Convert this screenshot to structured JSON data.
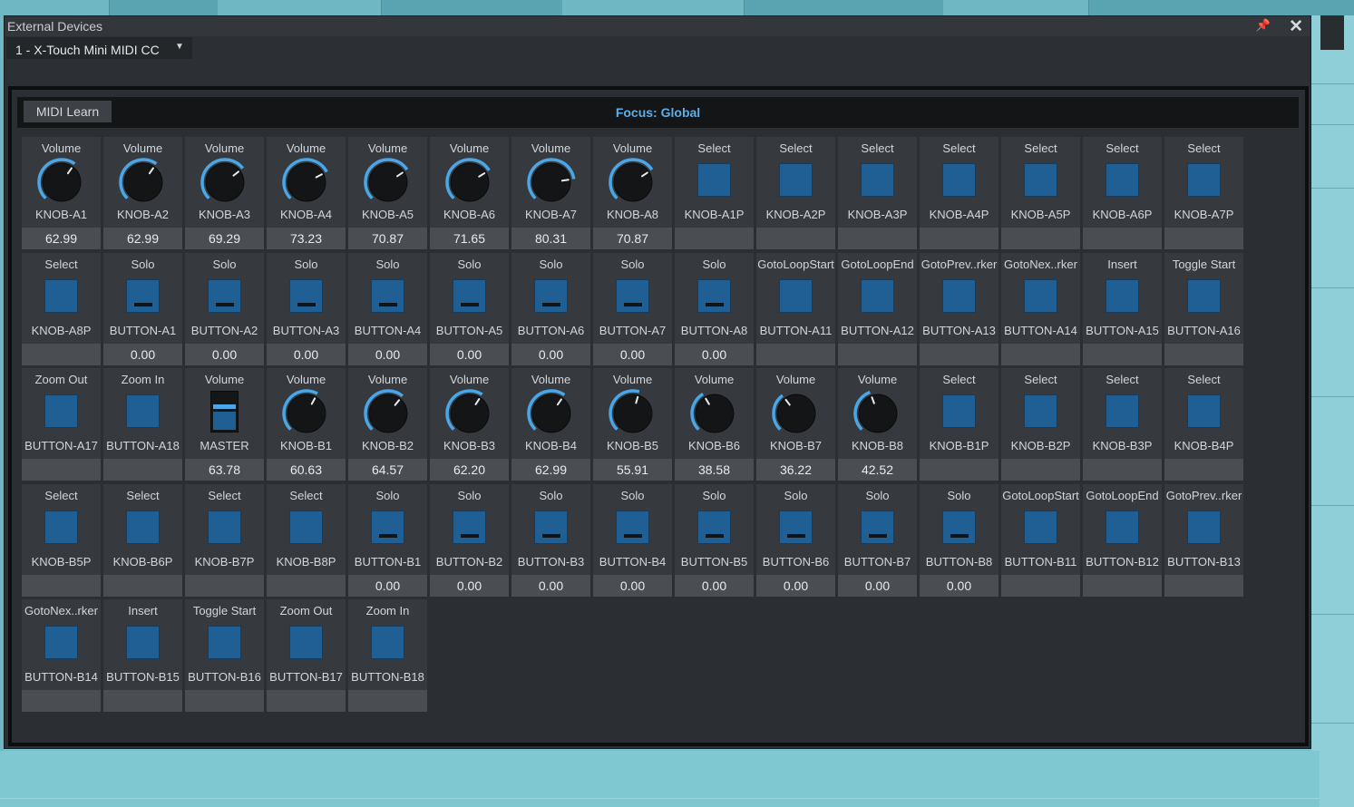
{
  "window": {
    "title": "External Devices",
    "device": "1 - X-Touch Mini MIDI CC"
  },
  "toolbar": {
    "learn": "MIDI Learn",
    "focus": "Focus: Global"
  },
  "colors": {
    "accent": "#4aa6e6",
    "pad": "#1f5f94",
    "focus_text": "#5eaee8"
  },
  "controls": [
    {
      "title": "Volume",
      "name": "KNOB-A1",
      "type": "knob",
      "value": "62.99"
    },
    {
      "title": "Volume",
      "name": "KNOB-A2",
      "type": "knob",
      "value": "62.99"
    },
    {
      "title": "Volume",
      "name": "KNOB-A3",
      "type": "knob",
      "value": "69.29"
    },
    {
      "title": "Volume",
      "name": "KNOB-A4",
      "type": "knob",
      "value": "73.23"
    },
    {
      "title": "Volume",
      "name": "KNOB-A5",
      "type": "knob",
      "value": "70.87"
    },
    {
      "title": "Volume",
      "name": "KNOB-A6",
      "type": "knob",
      "value": "71.65"
    },
    {
      "title": "Volume",
      "name": "KNOB-A7",
      "type": "knob",
      "value": "80.31"
    },
    {
      "title": "Volume",
      "name": "KNOB-A8",
      "type": "knob",
      "value": "70.87"
    },
    {
      "title": "Select",
      "name": "KNOB-A1P",
      "type": "pad",
      "value": ""
    },
    {
      "title": "Select",
      "name": "KNOB-A2P",
      "type": "pad",
      "value": ""
    },
    {
      "title": "Select",
      "name": "KNOB-A3P",
      "type": "pad",
      "value": ""
    },
    {
      "title": "Select",
      "name": "KNOB-A4P",
      "type": "pad",
      "value": ""
    },
    {
      "title": "Select",
      "name": "KNOB-A5P",
      "type": "pad",
      "value": ""
    },
    {
      "title": "Select",
      "name": "KNOB-A6P",
      "type": "pad",
      "value": ""
    },
    {
      "title": "Select",
      "name": "KNOB-A7P",
      "type": "pad",
      "value": ""
    },
    {
      "title": "Select",
      "name": "KNOB-A8P",
      "type": "pad",
      "value": ""
    },
    {
      "title": "Solo",
      "name": "BUTTON-A1",
      "type": "padbar",
      "value": "0.00"
    },
    {
      "title": "Solo",
      "name": "BUTTON-A2",
      "type": "padbar",
      "value": "0.00"
    },
    {
      "title": "Solo",
      "name": "BUTTON-A3",
      "type": "padbar",
      "value": "0.00"
    },
    {
      "title": "Solo",
      "name": "BUTTON-A4",
      "type": "padbar",
      "value": "0.00"
    },
    {
      "title": "Solo",
      "name": "BUTTON-A5",
      "type": "padbar",
      "value": "0.00"
    },
    {
      "title": "Solo",
      "name": "BUTTON-A6",
      "type": "padbar",
      "value": "0.00"
    },
    {
      "title": "Solo",
      "name": "BUTTON-A7",
      "type": "padbar",
      "value": "0.00"
    },
    {
      "title": "Solo",
      "name": "BUTTON-A8",
      "type": "padbar",
      "value": "0.00"
    },
    {
      "title": "GotoLoopStart",
      "name": "BUTTON-A11",
      "type": "pad",
      "value": ""
    },
    {
      "title": "GotoLoopEnd",
      "name": "BUTTON-A12",
      "type": "pad",
      "value": ""
    },
    {
      "title": "GotoPrev..rker",
      "name": "BUTTON-A13",
      "type": "pad",
      "value": ""
    },
    {
      "title": "GotoNex..rker",
      "name": "BUTTON-A14",
      "type": "pad",
      "value": ""
    },
    {
      "title": "Insert",
      "name": "BUTTON-A15",
      "type": "pad",
      "value": ""
    },
    {
      "title": "Toggle Start",
      "name": "BUTTON-A16",
      "type": "pad",
      "value": ""
    },
    {
      "title": "Zoom Out",
      "name": "BUTTON-A17",
      "type": "pad",
      "value": ""
    },
    {
      "title": "Zoom In",
      "name": "BUTTON-A18",
      "type": "pad",
      "value": ""
    },
    {
      "title": "Volume",
      "name": "MASTER",
      "type": "fader",
      "value": "63.78"
    },
    {
      "title": "Volume",
      "name": "KNOB-B1",
      "type": "knob",
      "value": "60.63"
    },
    {
      "title": "Volume",
      "name": "KNOB-B2",
      "type": "knob",
      "value": "64.57"
    },
    {
      "title": "Volume",
      "name": "KNOB-B3",
      "type": "knob",
      "value": "62.20"
    },
    {
      "title": "Volume",
      "name": "KNOB-B4",
      "type": "knob",
      "value": "62.99"
    },
    {
      "title": "Volume",
      "name": "KNOB-B5",
      "type": "knob",
      "value": "55.91"
    },
    {
      "title": "Volume",
      "name": "KNOB-B6",
      "type": "knob",
      "value": "38.58"
    },
    {
      "title": "Volume",
      "name": "KNOB-B7",
      "type": "knob",
      "value": "36.22"
    },
    {
      "title": "Volume",
      "name": "KNOB-B8",
      "type": "knob",
      "value": "42.52"
    },
    {
      "title": "Select",
      "name": "KNOB-B1P",
      "type": "pad",
      "value": ""
    },
    {
      "title": "Select",
      "name": "KNOB-B2P",
      "type": "pad",
      "value": ""
    },
    {
      "title": "Select",
      "name": "KNOB-B3P",
      "type": "pad",
      "value": ""
    },
    {
      "title": "Select",
      "name": "KNOB-B4P",
      "type": "pad",
      "value": ""
    },
    {
      "title": "Select",
      "name": "KNOB-B5P",
      "type": "pad",
      "value": ""
    },
    {
      "title": "Select",
      "name": "KNOB-B6P",
      "type": "pad",
      "value": ""
    },
    {
      "title": "Select",
      "name": "KNOB-B7P",
      "type": "pad",
      "value": ""
    },
    {
      "title": "Select",
      "name": "KNOB-B8P",
      "type": "pad",
      "value": ""
    },
    {
      "title": "Solo",
      "name": "BUTTON-B1",
      "type": "padbar",
      "value": "0.00"
    },
    {
      "title": "Solo",
      "name": "BUTTON-B2",
      "type": "padbar",
      "value": "0.00"
    },
    {
      "title": "Solo",
      "name": "BUTTON-B3",
      "type": "padbar",
      "value": "0.00"
    },
    {
      "title": "Solo",
      "name": "BUTTON-B4",
      "type": "padbar",
      "value": "0.00"
    },
    {
      "title": "Solo",
      "name": "BUTTON-B5",
      "type": "padbar",
      "value": "0.00"
    },
    {
      "title": "Solo",
      "name": "BUTTON-B6",
      "type": "padbar",
      "value": "0.00"
    },
    {
      "title": "Solo",
      "name": "BUTTON-B7",
      "type": "padbar",
      "value": "0.00"
    },
    {
      "title": "Solo",
      "name": "BUTTON-B8",
      "type": "padbar",
      "value": "0.00"
    },
    {
      "title": "GotoLoopStart",
      "name": "BUTTON-B11",
      "type": "pad",
      "value": ""
    },
    {
      "title": "GotoLoopEnd",
      "name": "BUTTON-B12",
      "type": "pad",
      "value": ""
    },
    {
      "title": "GotoPrev..rker",
      "name": "BUTTON-B13",
      "type": "pad",
      "value": ""
    },
    {
      "title": "GotoNex..rker",
      "name": "BUTTON-B14",
      "type": "pad",
      "value": ""
    },
    {
      "title": "Insert",
      "name": "BUTTON-B15",
      "type": "pad",
      "value": ""
    },
    {
      "title": "Toggle Start",
      "name": "BUTTON-B16",
      "type": "pad",
      "value": ""
    },
    {
      "title": "Zoom Out",
      "name": "BUTTON-B17",
      "type": "pad",
      "value": ""
    },
    {
      "title": "Zoom In",
      "name": "BUTTON-B18",
      "type": "pad",
      "value": ""
    }
  ]
}
